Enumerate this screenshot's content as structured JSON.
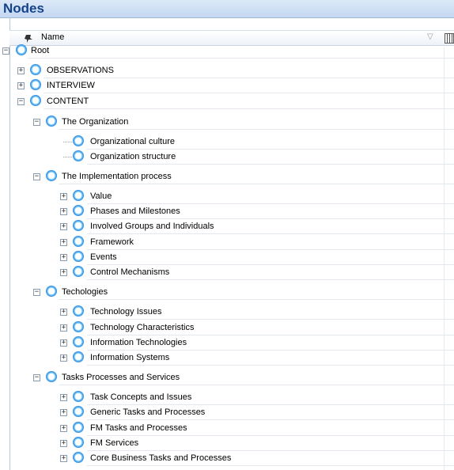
{
  "panel": {
    "title": "Nodes"
  },
  "header": {
    "name_label": "Name",
    "filter_icon": "funnel-icon",
    "grid_icon": "grid-icon"
  },
  "tree": [
    {
      "label": "Root",
      "level": 0,
      "expander": "minus"
    },
    {
      "label": "OBSERVATIONS",
      "level": 1,
      "expander": "plus"
    },
    {
      "label": "INTERVIEW",
      "level": 1,
      "expander": "plus"
    },
    {
      "label": "CONTENT",
      "level": 1,
      "expander": "minus"
    },
    {
      "label": "The Organization",
      "level": 2,
      "expander": "minus"
    },
    {
      "label": "Organizational culture",
      "level": 3,
      "expander": "none"
    },
    {
      "label": "Organization structure",
      "level": 3,
      "expander": "none"
    },
    {
      "label": "The Implementation process",
      "level": 2,
      "expander": "minus"
    },
    {
      "label": "Value",
      "level": 3,
      "expander": "plus"
    },
    {
      "label": "Phases and Milestones",
      "level": 3,
      "expander": "plus"
    },
    {
      "label": "Involved Groups and Individuals",
      "level": 3,
      "expander": "plus"
    },
    {
      "label": "Framework",
      "level": 3,
      "expander": "plus"
    },
    {
      "label": "Events",
      "level": 3,
      "expander": "plus"
    },
    {
      "label": "Control Mechanisms",
      "level": 3,
      "expander": "plus"
    },
    {
      "label": "Techologies",
      "level": 2,
      "expander": "minus"
    },
    {
      "label": "Technology Issues",
      "level": 3,
      "expander": "plus"
    },
    {
      "label": "Technology Characteristics",
      "level": 3,
      "expander": "plus"
    },
    {
      "label": "Information Technologies",
      "level": 3,
      "expander": "plus"
    },
    {
      "label": "Information Systems",
      "level": 3,
      "expander": "plus"
    },
    {
      "label": "Tasks Processes and Services",
      "level": 2,
      "expander": "minus"
    },
    {
      "label": "Task Concepts and Issues",
      "level": 3,
      "expander": "plus"
    },
    {
      "label": "Generic Tasks and Processes",
      "level": 3,
      "expander": "plus"
    },
    {
      "label": "FM Tasks and Processes",
      "level": 3,
      "expander": "plus"
    },
    {
      "label": "FM Services",
      "level": 3,
      "expander": "plus"
    },
    {
      "label": "Core Business Tasks and Processes",
      "level": 3,
      "expander": "plus"
    }
  ]
}
